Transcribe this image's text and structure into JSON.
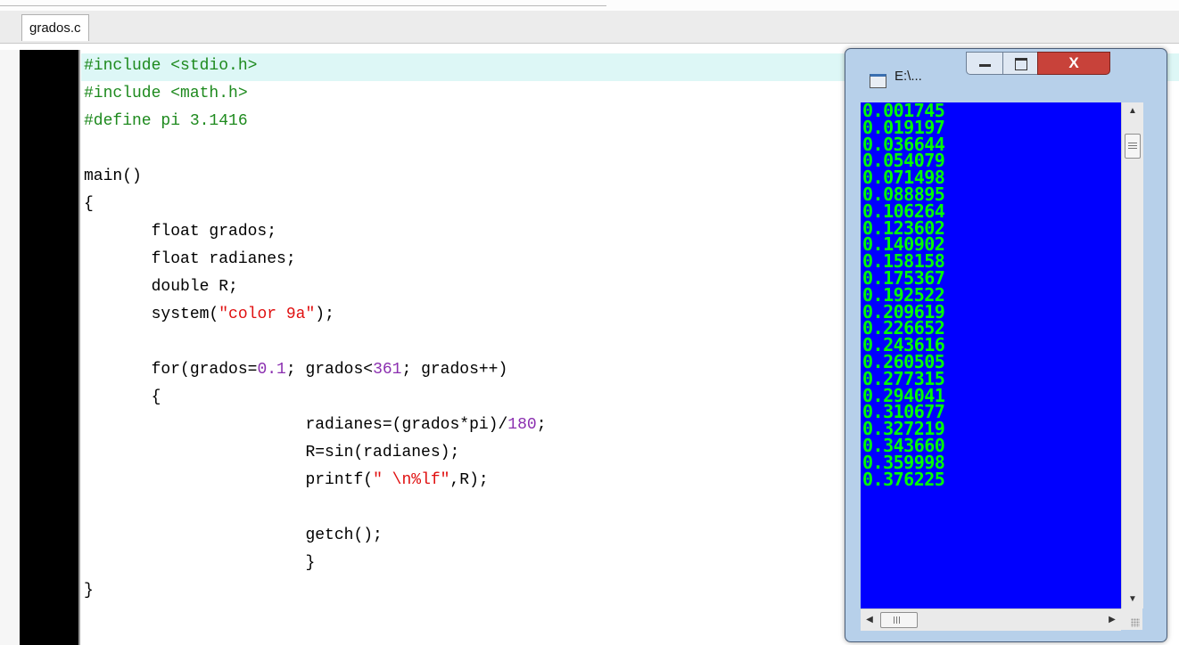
{
  "tab": {
    "label": "grados.c"
  },
  "code": {
    "lines": [
      [
        {
          "t": "#include <stdio.h>",
          "c": "tk-pp"
        }
      ],
      [
        {
          "t": "#include <math.h>",
          "c": "tk-pp"
        }
      ],
      [
        {
          "t": "#define pi 3.1416",
          "c": "tk-pp"
        }
      ],
      [],
      [
        {
          "t": "main()"
        }
      ],
      [
        {
          "t": "{"
        }
      ],
      [
        {
          "t": "       float grados;"
        }
      ],
      [
        {
          "t": "       float radianes;"
        }
      ],
      [
        {
          "t": "       double R;"
        }
      ],
      [
        {
          "t": "       system("
        },
        {
          "t": "\"color 9a\"",
          "c": "tk-str"
        },
        {
          "t": ");"
        }
      ],
      [],
      [
        {
          "t": "       for(grados="
        },
        {
          "t": "0.1",
          "c": "tk-num"
        },
        {
          "t": "; grados<"
        },
        {
          "t": "361",
          "c": "tk-num"
        },
        {
          "t": "; grados++)"
        }
      ],
      [
        {
          "t": "       {"
        }
      ],
      [
        {
          "t": "                       radianes=(grados*pi)/"
        },
        {
          "t": "180",
          "c": "tk-num"
        },
        {
          "t": ";"
        }
      ],
      [
        {
          "t": "                       R=sin(radianes);"
        }
      ],
      [
        {
          "t": "                       printf("
        },
        {
          "t": "\" \\n%lf\"",
          "c": "tk-str"
        },
        {
          "t": ",R);"
        }
      ],
      [],
      [
        {
          "t": "                       getch();"
        }
      ],
      [
        {
          "t": "                       }"
        }
      ],
      [
        {
          "t": "}"
        }
      ]
    ],
    "highlighted_line": 0
  },
  "console": {
    "title": "E:\\...",
    "close_glyph": "X",
    "output": [
      "0.001745",
      "0.019197",
      "0.036644",
      "0.054079",
      "0.071498",
      "0.088895",
      "0.106264",
      "0.123602",
      "0.140902",
      "0.158158",
      "0.175367",
      "0.192522",
      "0.209619",
      "0.226652",
      "0.243616",
      "0.260505",
      "0.277315",
      "0.294041",
      "0.310677",
      "0.327219",
      "0.343660",
      "0.359998",
      "0.376225"
    ],
    "colors": {
      "background": "#0000ff",
      "text": "#00ff00"
    }
  },
  "icons": {
    "window": "console-window-icon",
    "minimize": "minimize-icon",
    "maximize": "maximize-icon",
    "close": "close-icon"
  }
}
